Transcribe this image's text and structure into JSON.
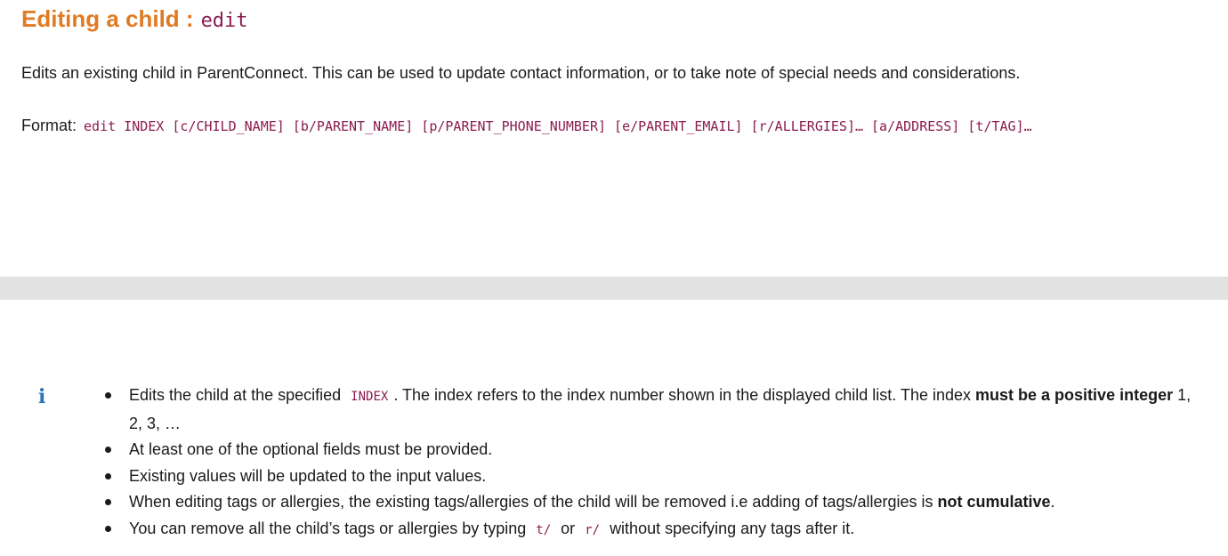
{
  "heading": {
    "title": "Editing a child :",
    "command": "edit"
  },
  "description": "Edits an existing child in ParentConnect. This can be used to update contact information, or to take note of special needs and considerations.",
  "format": {
    "label": "Format:",
    "code": "edit INDEX [c/CHILD_NAME] [b/PARENT_NAME] [p/PARENT_PHONE_NUMBER] [e/PARENT_EMAIL] [r/ALLERGIES]… [a/ADDRESS] [t/TAG]…"
  },
  "info_icon": "info-icon",
  "notes": [
    {
      "text1": "Edits the child at the specified",
      "code": "INDEX",
      "text2": ". The index refers to the index number shown in the displayed child list. The index",
      "bold": "must be a positive integer",
      "text3": "1, 2, 3, …"
    },
    {
      "text": "At least one of the optional fields must be provided."
    },
    {
      "text": "Existing values will be updated to the input values."
    },
    {
      "text1": "When editing tags or allergies, the existing tags/allergies of the child will be removed i.e adding of tags/allergies is",
      "bold": "not cumulative",
      "text2": "."
    },
    {
      "text1": "You can remove all the child’s tags or allergies by typing",
      "code1": "t/",
      "text2": "or",
      "code2": "r/",
      "text3": "without specifying any tags after it."
    }
  ]
}
